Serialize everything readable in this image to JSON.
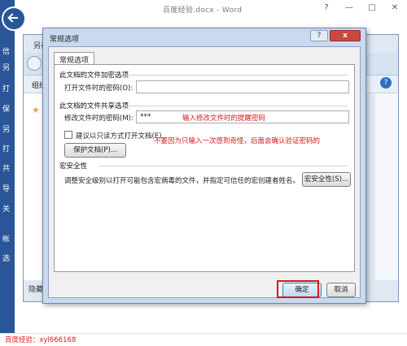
{
  "word": {
    "window_title": "百度经验.docx - Word",
    "rail_items": [
      "信",
      "另",
      "打",
      "保",
      "另",
      "打",
      "共",
      "导",
      "关",
      "帐",
      "选"
    ]
  },
  "saveas": {
    "title": "另存为",
    "organize_label": "组织",
    "hide_folders_label": "隐藏"
  },
  "dialog": {
    "title": "常规选项",
    "tab_label": "常规选项",
    "encrypt_group": "此文档的文件加密选项",
    "open_password_label": "打开文件时的密码(O):",
    "open_password_value": "",
    "share_group": "此文档的文件共享选项",
    "modify_password_label": "修改文件时的密码(M):",
    "modify_password_value": "***",
    "modify_hint": "输入修改文件时的提醒密码",
    "readonly_label": "建议以只读方式打开文档(E)",
    "readonly_hint": "不要因为只输入一次感到奇怪，后面会确认验证密码的",
    "protect_button": "保护文档(P)...",
    "macro_group": "宏安全性",
    "macro_text": "调整安全级别以打开可能包含宏病毒的文件，并指定可信任的宏创建者姓名。",
    "macro_button": "宏安全性(S)...",
    "ok_button": "确定",
    "cancel_button": "取消",
    "close_symbol": "x",
    "help_symbol": "?"
  },
  "watermark": "百度经验：xyl666168",
  "colors": {
    "accent_blue": "#2a5699",
    "hint_red": "#d2191b",
    "dialog_frame": "#c9d9ee"
  }
}
